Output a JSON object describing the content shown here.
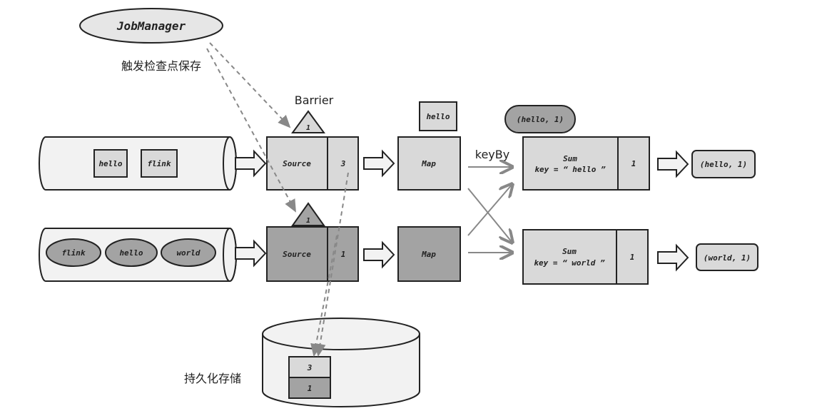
{
  "colors": {
    "light": "#d9d9d9",
    "dark": "#a3a3a3",
    "pipe": "#f2f2f2",
    "arrow": "#888888"
  },
  "job_manager": "JobManager",
  "trigger_label": "触发检查点保存",
  "barrier_label": "Barrier",
  "barrier_ids": [
    "1",
    "1"
  ],
  "keyby_label": "keyBy",
  "storage_label": "持久化存储",
  "row1": {
    "events": [
      "hello",
      "flink"
    ],
    "source": "Source",
    "source_state": "3",
    "map": "Map",
    "in_flight": "hello",
    "sum_line1": "Sum",
    "sum_line2": "key = “ hello ”",
    "sum_state": "1",
    "output": "(hello, 1)",
    "pending": "(hello, 1)"
  },
  "row2": {
    "events": [
      "flink",
      "hello",
      "world"
    ],
    "source": "Source",
    "source_state": "1",
    "map": "Map",
    "sum_line1": "Sum",
    "sum_line2": "key = “ world ”",
    "sum_state": "1",
    "output": "(world, 1)"
  },
  "storage": [
    "3",
    "1"
  ]
}
